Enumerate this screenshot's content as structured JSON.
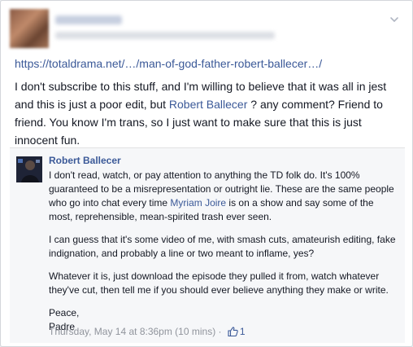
{
  "post": {
    "link_text": "https://totaldrama.net/…/man-of-god-father-robert-ballecer…/",
    "text_before": "I don't subscribe to this stuff, and I'm willing to believe that it was all in jest and this is just a poor edit, but ",
    "mention": "Robert Ballecer",
    "text_after": " ? any comment? Friend to friend. You know I'm trans, so I just want to make sure that this is just innocent fun."
  },
  "comment": {
    "author": "Robert Ballecer",
    "p1_before": "I don't read, watch, or pay attention to anything the TD folk do. It's 100% guaranteed to be a misrepresentation or outright lie. These are the same people who go into chat every time ",
    "p1_mention": "Myriam Joire",
    "p1_after": " is on a show and say some of the most, reprehensible, mean-spirited trash ever seen.",
    "p2": "I can guess that it's some video of me, with smash cuts, amateurish editing, fake indignation, and probably a line or two meant to inflame, yes?",
    "p3": "Whatever it is, just download the episode they pulled it from, watch whatever they've cut, then tell me if you should ever believe anything they make or write.",
    "p4_line1": "Peace,",
    "p4_line2": "Padre",
    "timestamp": "Thursday, May 14 at 8:36pm (10 mins)",
    "separator": " · ",
    "like_count": "1"
  },
  "icons": {
    "header_menu": "chevron-down-icon",
    "like": "thumbs-up-icon"
  },
  "colors": {
    "link": "#3b5998",
    "text": "#141823",
    "meta": "#90949c",
    "comment_bg": "#f6f7f9"
  }
}
